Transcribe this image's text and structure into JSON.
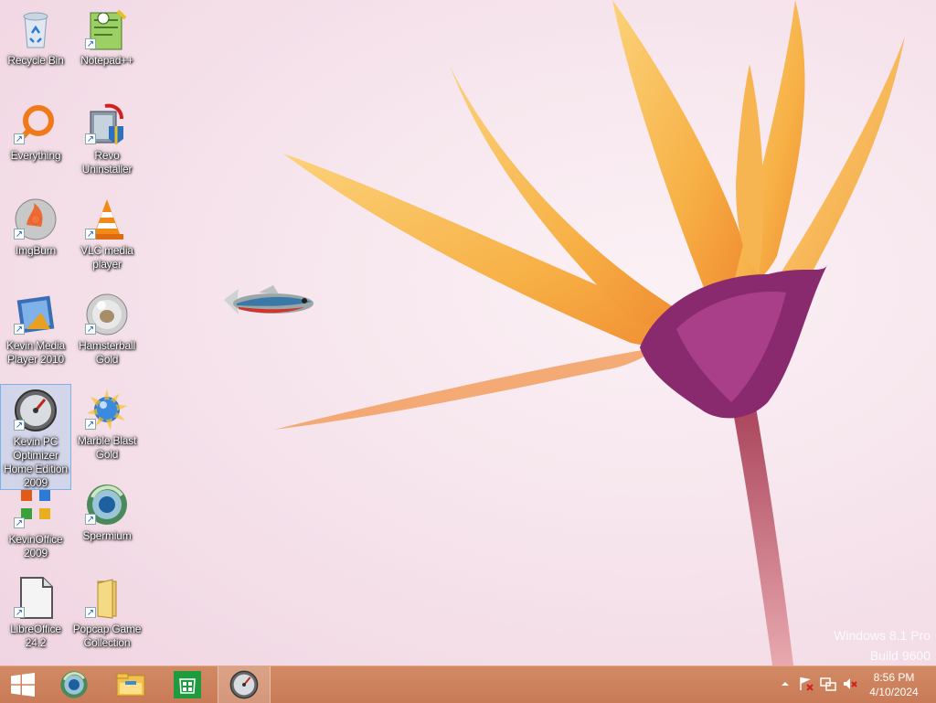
{
  "desktop": {
    "icons": [
      {
        "label": "Recycle Bin",
        "icon": "recycle-bin-icon"
      },
      {
        "label": "Notepad++",
        "icon": "notepad-plus-plus-icon"
      },
      {
        "label": "Everything",
        "icon": "everything-search-icon"
      },
      {
        "label": "Revo Uninstaller",
        "icon": "revo-uninstaller-icon"
      },
      {
        "label": "ImgBurn",
        "icon": "imgburn-icon"
      },
      {
        "label": "VLC media player",
        "icon": "vlc-cone-icon"
      },
      {
        "label": "Kevin Media Player 2010",
        "icon": "media-player-film-icon"
      },
      {
        "label": "Hamsterball Gold",
        "icon": "hamsterball-icon"
      },
      {
        "label": "Kevin PC Optimizer Home Edition 2009",
        "icon": "speedometer-icon"
      },
      {
        "label": "Marble Blast Gold",
        "icon": "marble-blast-icon"
      },
      {
        "label": "KevinOffice 2009",
        "icon": "office-logo-icon"
      },
      {
        "label": "Spermium",
        "icon": "spermium-browser-icon"
      },
      {
        "label": "LibreOffice 24.2",
        "icon": "libreoffice-document-icon"
      },
      {
        "label": "Popcap Game Collection",
        "icon": "folder-icon"
      }
    ],
    "selected_icon": "Kevin PC Optimizer Home Edition 2009"
  },
  "watermark": {
    "line1": "Windows 8.1 Pro",
    "line2": "Build 9600"
  },
  "taskbar": {
    "start_icon": "windows-logo-icon",
    "pinned": [
      "spermium-browser-icon",
      "file-explorer-icon",
      "windows-store-icon",
      "speedometer-icon"
    ],
    "clock": {
      "time": "8:56 PM",
      "date": "4/10/2024"
    }
  },
  "colors": {
    "taskbar": "#c97a57",
    "wallpaper_bg": "#f6e4ec",
    "petal": "#f6b04a"
  }
}
